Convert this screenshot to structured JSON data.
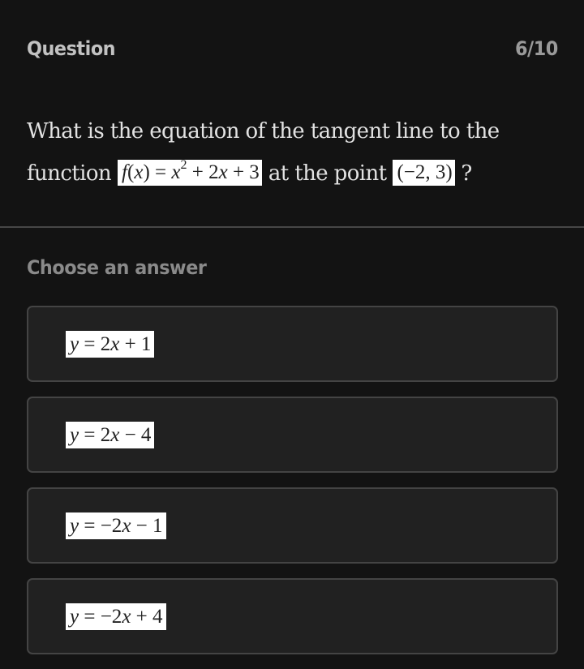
{
  "header": {
    "title": "Question",
    "counter": "6/10"
  },
  "question": {
    "text_before": "What is the equation of the tangent line to the function",
    "function_math": {
      "f": "f",
      "open": "(",
      "x": "x",
      "close_eq": ") = ",
      "x2": "x",
      "exp": "2",
      "rest": " + 2",
      "x3": "x",
      "tail": " + 3"
    },
    "text_middle": "at the point",
    "point_math": "(−2, 3)",
    "text_after": "?"
  },
  "answers_section": {
    "label": "Choose an answer",
    "options": [
      {
        "y": "y",
        "eq": " = 2",
        "x": "x",
        "tail": " + 1",
        "full": "y = 2x + 1"
      },
      {
        "y": "y",
        "eq": " = 2",
        "x": "x",
        "tail": " − 4",
        "full": "y = 2x − 4"
      },
      {
        "y": "y",
        "eq": " = −2",
        "x": "x",
        "tail": " − 1",
        "full": "y = −2x − 1"
      },
      {
        "y": "y",
        "eq": " = −2",
        "x": "x",
        "tail": " + 4",
        "full": "y = −2x + 4"
      }
    ]
  },
  "colors": {
    "background": "#131313",
    "card_background": "#212121",
    "card_border": "#444444",
    "math_background": "#ffffff"
  }
}
